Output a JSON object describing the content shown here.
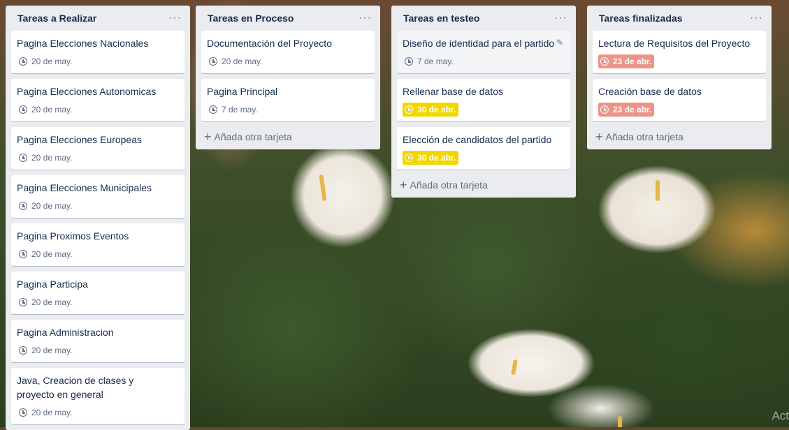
{
  "lists": [
    {
      "title": "Tareas a Realizar",
      "menu": "···",
      "cards": [
        {
          "title": "Pagina Elecciones Nacionales",
          "due": "20 de may."
        },
        {
          "title": "Pagina Elecciones Autonomicas",
          "due": "20 de may."
        },
        {
          "title": "Pagina Elecciones Europeas",
          "due": "20 de may."
        },
        {
          "title": "Pagina Elecciones Municipales",
          "due": "20 de may."
        },
        {
          "title": "Pagina Proximos Eventos",
          "due": "20 de may."
        },
        {
          "title": "Pagina Participa",
          "due": "20 de may."
        },
        {
          "title": "Pagina Administracion",
          "due": "20 de may."
        },
        {
          "title": "Java, Creacion de clases y proyecto en general",
          "due": "20 de may."
        }
      ]
    },
    {
      "title": "Tareas en Proceso",
      "menu": "···",
      "cards": [
        {
          "title": "Documentación del Proyecto",
          "due": "20 de may."
        },
        {
          "title": "Pagina Principal",
          "due": "7 de may."
        }
      ],
      "add_label": "Añada otra tarjeta"
    },
    {
      "title": "Tareas en testeo",
      "menu": "···",
      "cards": [
        {
          "title": "Diseño de identidad para el partido",
          "due": "7 de may.",
          "edit_icon": "pencil-icon"
        },
        {
          "title": "Rellenar base de datos",
          "due": "30 de abr.",
          "due_color": "#f2d600"
        },
        {
          "title": "Elección de candidatos del partido",
          "due": "30 de abr.",
          "due_color": "#f2d600"
        }
      ],
      "add_label": "Añada otra tarjeta"
    },
    {
      "title": "Tareas finalizadas",
      "menu": "···",
      "cards": [
        {
          "title": "Lectura de Requisitos del Proyecto",
          "due": "23 de abr.",
          "due_color": "#ec9488"
        },
        {
          "title": "Creación base de datos",
          "due": "23 de abr.",
          "due_color": "#ec9488"
        }
      ],
      "add_label": "Añada otra tarjeta"
    }
  ],
  "watermark": "Act"
}
